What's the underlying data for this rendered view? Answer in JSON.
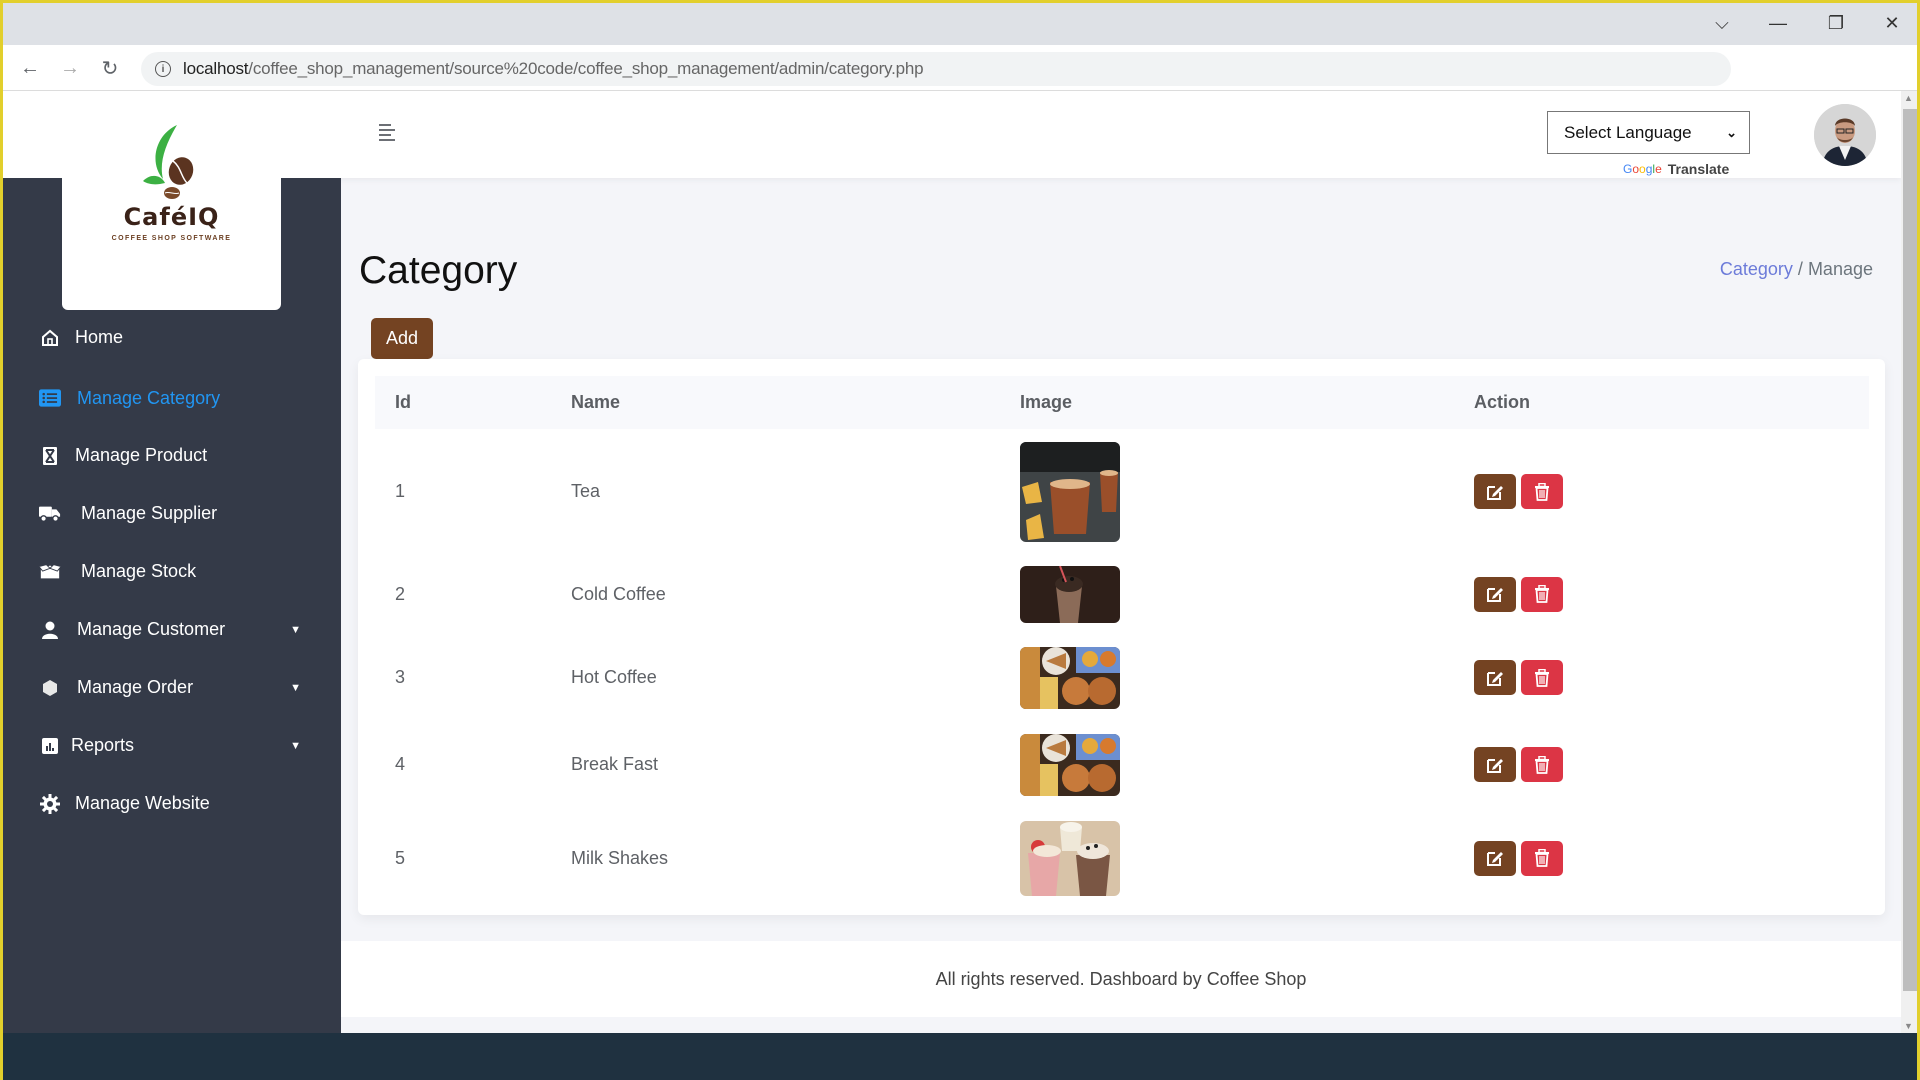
{
  "browser": {
    "url_host": "localhost",
    "url_path": "/coffee_shop_management/source%20code/coffee_shop_management/admin/category.php",
    "back_icon": "arrow-left-icon",
    "forward_icon": "arrow-right-icon",
    "reload_icon": "reload-icon",
    "info_icon": "info-icon"
  },
  "window_controls": {
    "tabs_menu": "⌵",
    "minimize": "—",
    "restore": "❐",
    "close": "✕"
  },
  "header": {
    "language_select": "Select Language",
    "google_label": "Google",
    "translate_label": "Translate"
  },
  "logo": {
    "name": "CaféIQ",
    "tagline": "COFFEE SHOP SOFTWARE"
  },
  "sidebar": {
    "items": [
      {
        "label": "Home",
        "icon": "home-icon",
        "active": false
      },
      {
        "label": "Manage Category",
        "icon": "list-icon",
        "active": true
      },
      {
        "label": "Manage Product",
        "icon": "product-icon",
        "active": false
      },
      {
        "label": "Manage Supplier",
        "icon": "truck-icon",
        "active": false
      },
      {
        "label": "Manage Stock",
        "icon": "box-icon",
        "active": false
      },
      {
        "label": "Manage Customer",
        "icon": "user-icon",
        "active": false,
        "has_dropdown": true
      },
      {
        "label": "Manage Order",
        "icon": "order-icon",
        "active": false,
        "has_dropdown": true
      },
      {
        "label": "Reports",
        "icon": "chart-icon",
        "active": false,
        "has_dropdown": true
      },
      {
        "label": "Manage Website",
        "icon": "gear-icon",
        "active": false
      }
    ]
  },
  "page": {
    "title": "Category",
    "breadcrumb": {
      "link": "Category",
      "separator": " / ",
      "current": "Manage"
    },
    "add_label": "Add"
  },
  "table": {
    "columns": [
      "Id",
      "Name",
      "Image",
      "Action"
    ],
    "rows": [
      {
        "id": "1",
        "name": "Tea",
        "image": "tea-image"
      },
      {
        "id": "2",
        "name": "Cold Coffee",
        "image": "cold-coffee-image"
      },
      {
        "id": "3",
        "name": "Hot Coffee",
        "image": "hot-coffee-image"
      },
      {
        "id": "4",
        "name": "Break Fast",
        "image": "breakfast-image"
      },
      {
        "id": "5",
        "name": "Milk Shakes",
        "image": "milk-shakes-image"
      }
    ]
  },
  "footer": {
    "text": "All rights reserved. Dashboard by Coffee Shop"
  },
  "colors": {
    "brand_brown": "#744322",
    "danger_red": "#dc3545",
    "sidebar_bg": "#343a48",
    "active_blue": "#2196f3",
    "breadcrumb_link": "#6c7bd9"
  }
}
